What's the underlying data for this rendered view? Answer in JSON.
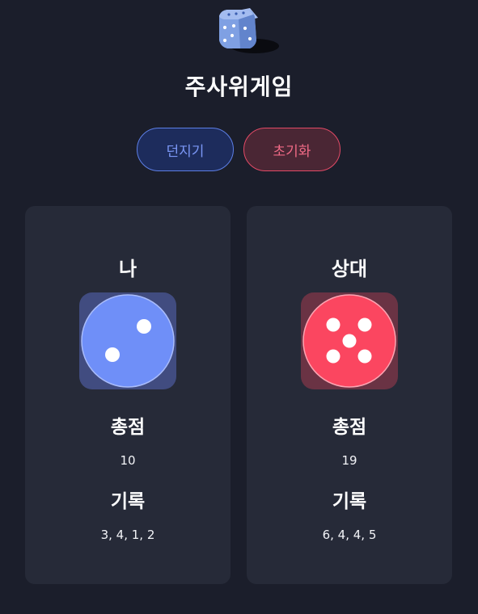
{
  "app": {
    "title": "주사위게임",
    "logo_icon": "dice-icon"
  },
  "controls": {
    "roll_label": "던지기",
    "reset_label": "초기화",
    "roll_color": "#7b97f6",
    "reset_color": "#f06a86"
  },
  "players": {
    "me": {
      "name": "나",
      "die_face": 2,
      "die_color": "#6f8ff8",
      "total_label": "총점",
      "total": "10",
      "history_label": "기록",
      "history": "3, 4, 1, 2"
    },
    "opponent": {
      "name": "상대",
      "die_face": 5,
      "die_color": "#fb4660",
      "total_label": "총점",
      "total": "19",
      "history_label": "기록",
      "history": "6, 4, 4, 5"
    }
  }
}
